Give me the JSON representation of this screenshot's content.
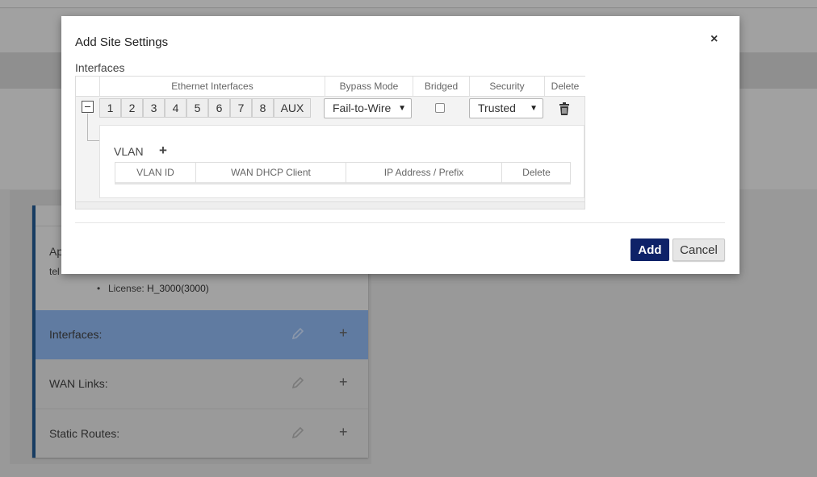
{
  "background": {
    "card": {
      "app_label": "Ap",
      "tel_label": "tel",
      "license_label": "License:",
      "license_value": "H_3000(3000)",
      "rows": [
        {
          "label": "Interfaces:"
        },
        {
          "label": "WAN Links:"
        },
        {
          "label": "Static Routes:"
        }
      ]
    }
  },
  "modal": {
    "title": "Add Site Settings",
    "close_glyph": "×",
    "section_label": "Interfaces",
    "table": {
      "headers": {
        "ethernet": "Ethernet Interfaces",
        "bypass": "Bypass Mode",
        "bridged": "Bridged",
        "security": "Security",
        "delete": "Delete"
      },
      "ports": [
        "1",
        "2",
        "3",
        "4",
        "5",
        "6",
        "7",
        "8",
        "AUX"
      ],
      "bypass_value": "Fail-to-Wire",
      "bridged_checked": false,
      "security_value": "Trusted"
    },
    "vlan": {
      "label": "VLAN",
      "add_glyph": "+",
      "headers": {
        "vlan_id": "VLAN ID",
        "dhcp": "WAN DHCP Client",
        "ip": "IP Address / Prefix",
        "delete": "Delete"
      }
    },
    "buttons": {
      "add": "Add",
      "cancel": "Cancel"
    }
  },
  "colors": {
    "primary_button": "#0e2268",
    "highlight_row": "#607ba1",
    "card_accent": "#173c62"
  },
  "icons": {
    "delete": "trash-icon",
    "edit": "pencil-icon",
    "collapse": "collapse-minus-icon",
    "dropdown": "caret-down-icon"
  }
}
